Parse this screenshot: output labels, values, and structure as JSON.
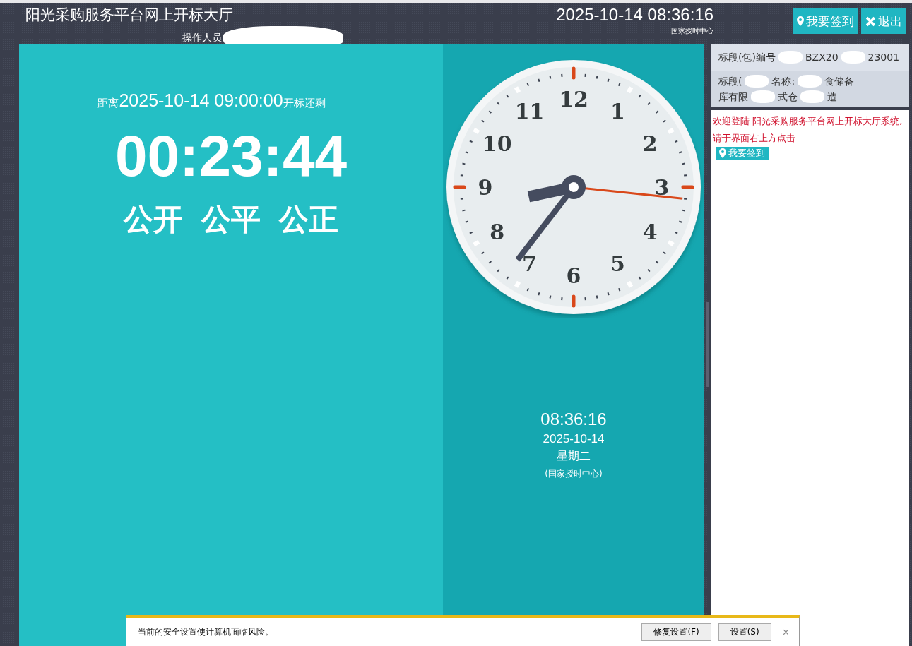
{
  "header": {
    "title": "阳光采购服务平台网上开标大厅",
    "operator": "操作人员",
    "datetime": "2025-10-14 08:36:16",
    "time_source": "国家授时中心",
    "buttons": [
      {
        "kind": "signin",
        "label": "我要签到"
      },
      {
        "kind": "logout",
        "label": "退出"
      }
    ]
  },
  "countdown": {
    "prefix": "距离",
    "target": "2025-10-14 09:00:00",
    "suffix": "开标还剩",
    "remaining": "00:23:44",
    "slogans": [
      "公开",
      "公平",
      "公正"
    ]
  },
  "clock": {
    "numerals": [
      "12",
      "1",
      "2",
      "3",
      "4",
      "5",
      "6",
      "7",
      "8",
      "9",
      "10",
      "11"
    ],
    "time": "08:36:16",
    "date": "2025-10-14",
    "weekday": "星期二",
    "source": "(国家授时中心)"
  },
  "info": {
    "rows": [
      {
        "parts": [
          "标段(包)编号",
          "BZX20",
          "23001"
        ]
      },
      {
        "parts": [
          "标段(",
          "名称:",
          "食储备"
        ]
      },
      {
        "parts": [
          "库有限",
          "式仓",
          "造"
        ]
      }
    ],
    "welcome": "欢迎登陆 阳光采购服务平台网上开标大厅系统,请于界面右上方点击",
    "signin_badge": "我要签到"
  },
  "notification": {
    "message": "当前的安全设置使计算机面临风险。",
    "buttons": [
      "修复设置(F)",
      "设置(S)"
    ],
    "close": "×"
  }
}
